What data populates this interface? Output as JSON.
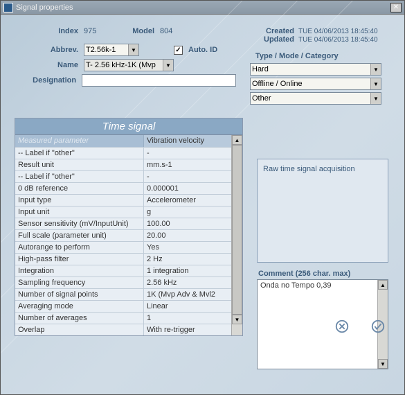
{
  "window": {
    "title": "Signal properties"
  },
  "header": {
    "index_label": "Index",
    "index_value": "975",
    "model_label": "Model",
    "model_value": "804",
    "abbrev_label": "Abbrev.",
    "abbrev_value": "T2.56k-1",
    "autoid_label": "Auto. ID",
    "autoid_checked": "✓",
    "name_label": "Name",
    "name_value": "T- 2.56 kHz-1K (Mvp",
    "designation_label": "Designation",
    "designation_value": "",
    "created_label": "Created",
    "created_value": "TUE 04/06/2013 18:45:40",
    "updated_label": "Updated",
    "updated_value": "TUE 04/06/2013 18:45:40"
  },
  "tmc": {
    "header": "Type / Mode / Category",
    "type": "Hard",
    "mode": "Offline / Online",
    "category": "Other"
  },
  "timesignal": {
    "title": "Time signal",
    "header_param": "Measured parameter",
    "header_value": "Vibration velocity",
    "rows": [
      {
        "label": "-- Label if \"other\"",
        "value": "-"
      },
      {
        "label": "Result unit",
        "value": "mm.s-1"
      },
      {
        "label": "-- Label if \"other\"",
        "value": "-"
      },
      {
        "label": "0 dB reference",
        "value": "0.000001"
      },
      {
        "label": "Input type",
        "value": "Accelerometer"
      },
      {
        "label": "Input unit",
        "value": "g"
      },
      {
        "label": "Sensor sensitivity (mV/InputUnit)",
        "value": "100.00"
      },
      {
        "label": "Full scale (parameter unit)",
        "value": "20.00"
      },
      {
        "label": "Autorange to perform",
        "value": "Yes"
      },
      {
        "label": "High-pass filter",
        "value": "2 Hz"
      },
      {
        "label": "Integration",
        "value": "1 integration"
      },
      {
        "label": "Sampling frequency",
        "value": "2.56 kHz"
      },
      {
        "label": "Number of signal points",
        "value": "1K (Mvp Adv & Mvl2"
      },
      {
        "label": "Averaging mode",
        "value": "Linear"
      },
      {
        "label": "Number of averages",
        "value": "1"
      },
      {
        "label": "Overlap",
        "value": "With re-trigger"
      }
    ]
  },
  "acquisition": {
    "text": "Raw time signal acquisition"
  },
  "comment": {
    "label": "Comment (256 char. max)",
    "text": "Onda no Tempo 0,39"
  }
}
